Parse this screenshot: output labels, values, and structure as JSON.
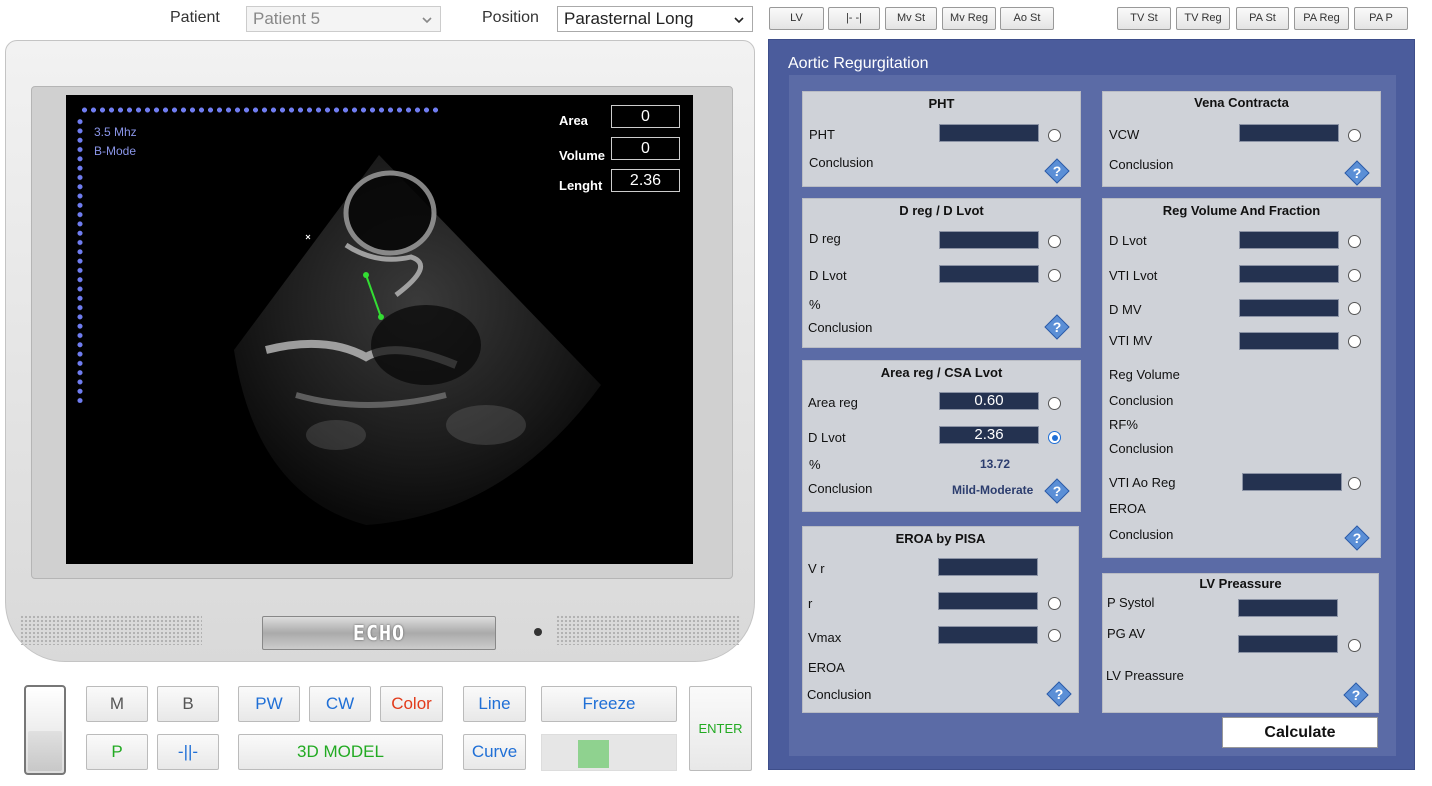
{
  "top": {
    "patient_label": "Patient",
    "patient_value": "Patient 5",
    "position_label": "Position",
    "position_value": "Parasternal Long",
    "tabs_left": [
      "LV",
      "|- -|",
      "Mv St",
      "Mv Reg",
      "Ao St"
    ],
    "tabs_right": [
      "TV St",
      "TV Reg",
      "PA St",
      "PA Reg",
      "PA P"
    ]
  },
  "screen": {
    "freq": "3.5 Mhz",
    "mode": "B-Mode",
    "area_label": "Area",
    "area_value": "0",
    "volume_label": "Volume",
    "volume_value": "0",
    "length_label": "Lenght",
    "length_value": "2.36",
    "brand": "ECHO"
  },
  "controls": {
    "m": "M",
    "b": "B",
    "p": "P",
    "caliper": "-||-",
    "pw": "PW",
    "cw": "CW",
    "color": "Color",
    "model3d": "3D MODEL",
    "line": "Line",
    "curve": "Curve",
    "freeze": "Freeze",
    "enter": "ENTER",
    "slider_level": 0.35
  },
  "panel": {
    "title": "Aortic Regurgitation",
    "pht": {
      "title": "PHT",
      "pht": "PHT",
      "conclusion": "Conclusion"
    },
    "dreg": {
      "title": "D reg / D Lvot",
      "dreg": "D reg",
      "dlvot": "D Lvot",
      "pct": "%",
      "conclusion": "Conclusion"
    },
    "area": {
      "title": "Area reg / CSA Lvot",
      "areareg": "Area reg",
      "areareg_value": "0.60",
      "dlvot": "D Lvot",
      "dlvot_value": "2.36",
      "pct": "%",
      "pct_value": "13.72",
      "conclusion": "Conclusion",
      "conclusion_value": "Mild-Moderate"
    },
    "pisa": {
      "title": "EROA by PISA",
      "vr": "V r",
      "r": "r",
      "vmax": "Vmax",
      "eroa": "EROA",
      "conclusion": "Conclusion"
    },
    "vena": {
      "title": "Vena Contracta",
      "vcw": "VCW",
      "conclusion": "Conclusion"
    },
    "regvol": {
      "title": "Reg Volume And Fraction",
      "dlvot": "D Lvot",
      "vtilvot": "VTI Lvot",
      "dmv": "D MV",
      "vtimv": "VTI MV",
      "regvolume": "Reg Volume",
      "conclusion1": "Conclusion",
      "rf": "RF%",
      "conclusion2": "Conclusion",
      "vtiaoreg": "VTI Ao Reg",
      "eroa": "EROA",
      "conclusion3": "Conclusion"
    },
    "lvp": {
      "title": "LV Preassure",
      "psystol": "P Systol",
      "pgav": "PG AV",
      "lvpressure": "LV Preassure"
    },
    "calculate": "Calculate"
  },
  "colors": {
    "panel": "#4b5c9c",
    "field": "#243250",
    "green": "#22aa22",
    "blue": "#1f6fd6",
    "red": "#e23a1a",
    "measure": "#33dd33"
  }
}
